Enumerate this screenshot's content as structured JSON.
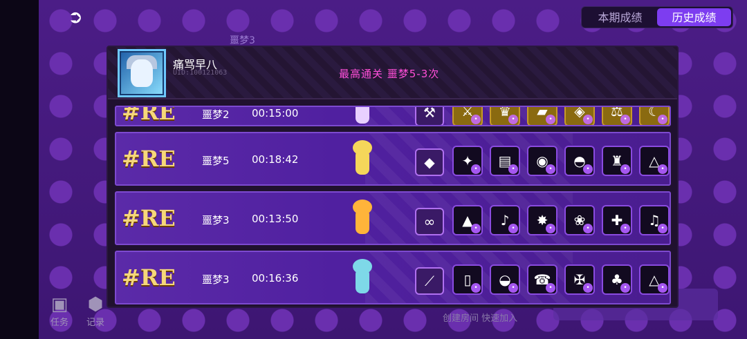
{
  "top": {
    "back_icon": "back-arrow-icon",
    "bg_title": "噩梦3"
  },
  "tabs": [
    {
      "label": "本期成绩",
      "active": false
    },
    {
      "label": "历史成绩",
      "active": true
    }
  ],
  "bottom_left": [
    {
      "icon": "clipboard-icon",
      "label": "任务"
    },
    {
      "icon": "hexagon-icon",
      "label": "记录"
    }
  ],
  "bottom_text": "创建房间   快速加入",
  "player": {
    "name": "痛骂早八",
    "uid": "UID:100121063",
    "best_clear": "最高通关 噩梦5-3次"
  },
  "records": [
    {
      "rank": "#RE",
      "difficulty": "噩梦2",
      "time": "00:15:00",
      "hero_color": "#e8d0ff",
      "weapon_icon": "axe-icon",
      "items": [
        "hammer-icon",
        "trophy-icon",
        "boot-icon",
        "shield-icon",
        "scale-icon",
        "blade-icon"
      ],
      "item_gold": [
        true,
        true,
        true,
        true,
        true,
        true
      ]
    },
    {
      "rank": "#RE",
      "difficulty": "噩梦5",
      "time": "00:18:42",
      "hero_color": "#f5d65a",
      "weapon_icon": "horn-icon",
      "items": [
        "crystal-icon",
        "chest-icon",
        "cannon-icon",
        "bowl-icon",
        "crown-icon",
        "triangle-icon"
      ],
      "item_gold": [
        false,
        false,
        false,
        false,
        false,
        false
      ]
    },
    {
      "rank": "#RE",
      "difficulty": "噩梦3",
      "time": "00:13:50",
      "hero_color": "#ffb43a",
      "weapon_icon": "glasses-icon",
      "items": [
        "slime-icon",
        "lyre-icon",
        "bomb-icon",
        "flower-icon",
        "cross-icon",
        "note-icon"
      ],
      "item_gold": [
        false,
        false,
        false,
        false,
        false,
        false
      ]
    },
    {
      "rank": "#RE",
      "difficulty": "噩梦3",
      "time": "00:16:36",
      "hero_color": "#7ed8e8",
      "weapon_icon": "sword-icon",
      "items": [
        "card-icon",
        "hat-icon",
        "phone-icon",
        "rune-icon",
        "clover-icon",
        "triangle-icon"
      ],
      "item_gold": [
        false,
        false,
        false,
        false,
        false,
        false
      ]
    }
  ],
  "colors": {
    "accent": "#7d3df0",
    "rank": "#f6d77a",
    "best_clear": "#ff4fd8"
  }
}
